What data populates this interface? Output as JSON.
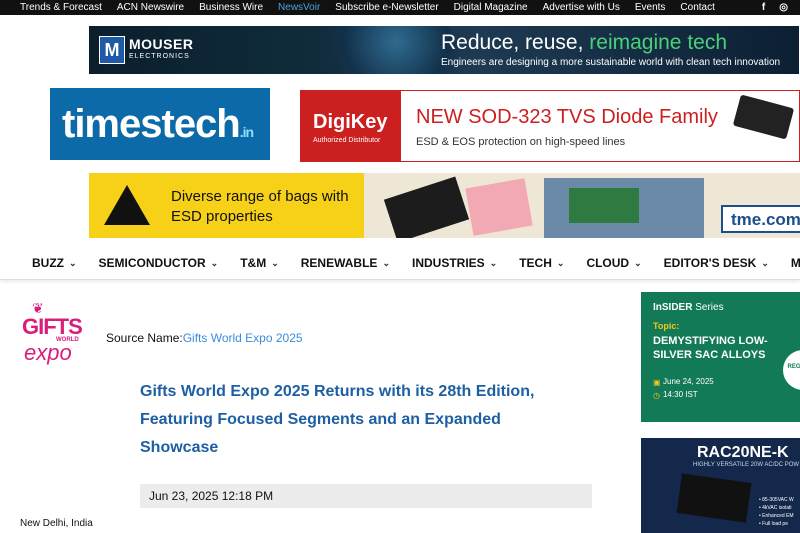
{
  "topbar": {
    "links": [
      "Trends & Forecast",
      "ACN Newswire",
      "Business Wire",
      "NewsVoir",
      "Subscribe e-Newsletter",
      "Digital Magazine",
      "Advertise with Us",
      "Events",
      "Contact"
    ],
    "active_link": "NewsVoir",
    "social": {
      "facebook": "f",
      "instagram": "◎"
    }
  },
  "banner_mouser": {
    "brand": "MOUSER",
    "brand_sub": "ELECTRONICS",
    "logo_letter": "M",
    "headline_part1": "Reduce, reuse, ",
    "headline_part2": "reimagine tech",
    "sub": "Engineers are designing a more sustainable world with clean tech innovation"
  },
  "site_logo": {
    "name": "timestech",
    "suffix": ".in"
  },
  "banner_digikey": {
    "brand": "DigiKey",
    "brand_sub": "Authorized Distributor",
    "headline": "NEW SOD-323 TVS Diode Family",
    "sub": "ESD & EOS protection on high-speed lines"
  },
  "banner_tme": {
    "text": "Diverse range of bags with ESD properties",
    "brand": "tme.com"
  },
  "nav": {
    "items": [
      "BUZZ",
      "SEMICONDUCTOR",
      "T&M",
      "RENEWABLE",
      "INDUSTRIES",
      "TECH",
      "CLOUD",
      "EDITOR'S DESK",
      "MORE"
    ]
  },
  "article": {
    "logo": {
      "gifts": "GIFTS",
      "world": "WORLD",
      "expo": "expo",
      "bow": "❦"
    },
    "source_label": "Source Name:",
    "source_name": "Gifts World Expo 2025",
    "title": "Gifts World Expo 2025 Returns with its 28th Edition, Featuring Focused Segments and an Expanded Showcase",
    "date": "Jun 23, 2025 12:18 PM",
    "dateline": "New Delhi, India"
  },
  "ad_insider": {
    "series_a": "InSIDER",
    "series_b": " Series",
    "topic": "Topic:",
    "headline": "DEMYSTIFYING LOW-SILVER SAC ALLOYS",
    "date": "June 24, 2025",
    "time": "14:30 IST",
    "register": "REGI NOW"
  },
  "ad_rac": {
    "headline": "RAC20NE-K",
    "sub": "HIGHLY VERSATILE 20W AC/DC POW",
    "features": [
      "• 85-305VAC W",
      "• 4kVAC isolati",
      "• Enhanced EM",
      "• Full load pe"
    ]
  }
}
